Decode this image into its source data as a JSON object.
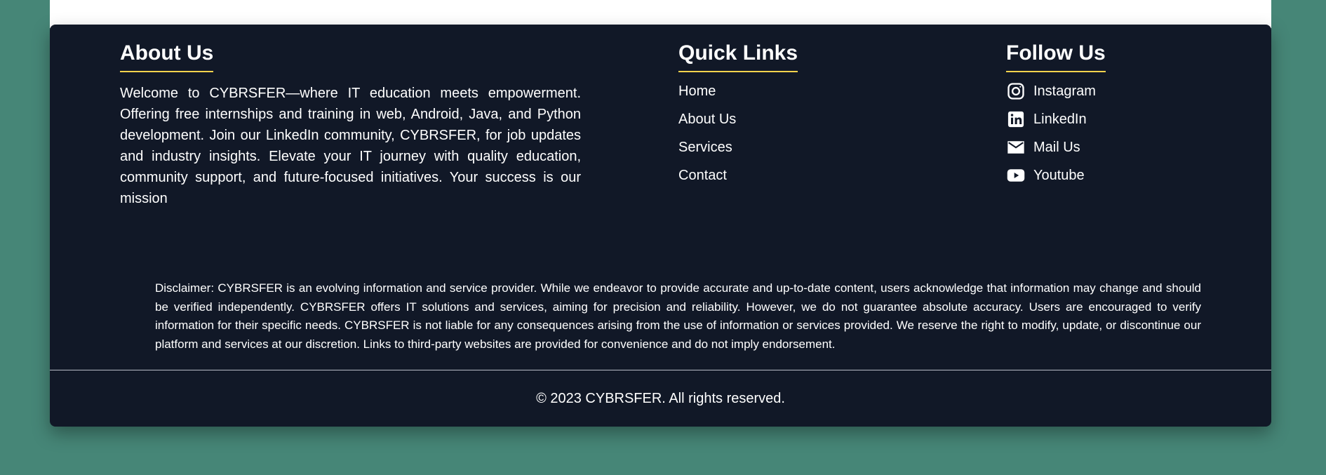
{
  "about": {
    "heading": "About Us",
    "text": "Welcome to CYBRSFER—where IT education meets empowerment. Offering free internships and training in web, Android, Java, and Python development. Join our LinkedIn community, CYBRSFER, for job updates and industry insights. Elevate your IT journey with quality education, community support, and future-focused initiatives. Your success is our mission"
  },
  "quick_links": {
    "heading": "Quick Links",
    "items": [
      {
        "label": "Home"
      },
      {
        "label": "About Us"
      },
      {
        "label": "Services"
      },
      {
        "label": "Contact"
      }
    ]
  },
  "follow": {
    "heading": "Follow Us",
    "items": [
      {
        "label": "Instagram",
        "icon": "instagram-icon"
      },
      {
        "label": "LinkedIn",
        "icon": "linkedin-icon"
      },
      {
        "label": "Mail Us",
        "icon": "mail-icon"
      },
      {
        "label": "Youtube",
        "icon": "youtube-icon"
      }
    ]
  },
  "disclaimer": "Disclaimer: CYBRSFER is an evolving information and service provider. While we endeavor to provide accurate and up-to-date content, users acknowledge that information may change and should be verified independently. CYBRSFER offers IT solutions and services, aiming for precision and reliability. However, we do not guarantee absolute accuracy. Users are encouraged to verify information for their specific needs. CYBRSFER is not liable for any consequences arising from the use of information or services provided. We reserve the right to modify, update, or discontinue our platform and services at our discretion. Links to third-party websites are provided for convenience and do not imply endorsement.",
  "copyright": "© 2023 CYBRSFER. All rights reserved.",
  "colors": {
    "page_background": "#468677",
    "footer_background": "#111827",
    "heading_underline": "#fcd34d",
    "text": "#ffffff"
  }
}
